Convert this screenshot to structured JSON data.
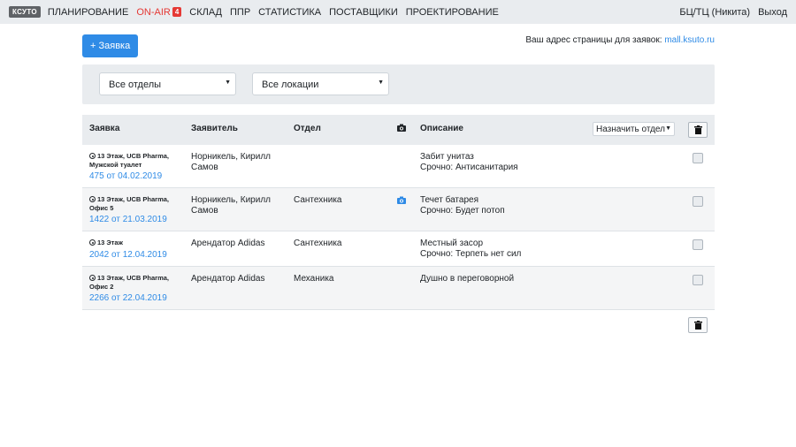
{
  "nav": {
    "logo": "КСУТО",
    "items": [
      "ПЛАНИРОВАНИЕ",
      "ON-AIR",
      "СКЛАД",
      "ППР",
      "СТАТИСТИКА",
      "ПОСТАВЩИКИ",
      "ПРОЕКТИРОВАНИЕ"
    ],
    "onair_badge": "4",
    "user": "БЦ/ТЦ (Никита)",
    "logout": "Выход"
  },
  "actions": {
    "new_request": "+ Заявка",
    "address_label": "Ваш адрес страницы для заявок:",
    "address_link": "mall.ksuto.ru"
  },
  "filters": {
    "departments": "Все отделы",
    "locations": "Все локации"
  },
  "table": {
    "headers": {
      "request": "Заявка",
      "applicant": "Заявитель",
      "department": "Отдел",
      "description": "Описание",
      "assign": "Назначить отдел"
    },
    "rows": [
      {
        "location": "13 Этаж, UCB Pharma, Мужской туалет",
        "number": "475 от 04.02.2019",
        "applicant": "Норникель, Кирилл Самов",
        "department": "",
        "photo": false,
        "description": "Забит унитаз",
        "urgency": "Срочно: Антисанитария"
      },
      {
        "location": "13 Этаж, UCB Pharma, Офис 5",
        "number": "1422 от 21.03.2019",
        "applicant": "Норникель, Кирилл Самов",
        "department": "Сантехника",
        "photo": true,
        "description": "Течет батарея",
        "urgency": "Срочно: Будет потоп"
      },
      {
        "location": "13 Этаж",
        "number": "2042 от 12.04.2019",
        "applicant": "Арендатор Adidas",
        "department": "Сантехника",
        "photo": false,
        "description": "Местный засор",
        "urgency": "Срочно: Терпеть нет сил"
      },
      {
        "location": "13 Этаж, UCB Pharma, Офис 2",
        "number": "2266 от 22.04.2019",
        "applicant": "Арендатор Adidas",
        "department": "Механика",
        "photo": false,
        "description": "Душно в переговорной",
        "urgency": ""
      }
    ]
  },
  "colors": {
    "accent": "#2f8be6",
    "on_air": "#e53935",
    "bar_bg": "#e9ecef"
  }
}
